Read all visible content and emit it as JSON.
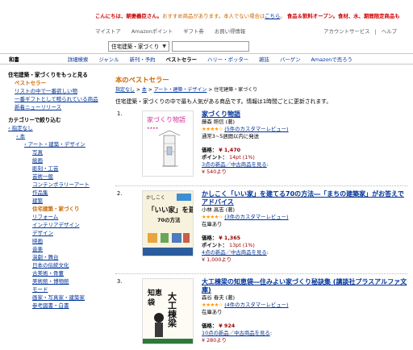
{
  "greeting": {
    "name": "こんにちは、朝妻義臣さん。",
    "mid": "おすすめ商品があります。本人でない場合は",
    "here": "こちら",
    "tail": "。",
    "promo": "食品＆飲料オープン。食材、水、期間限定商品も"
  },
  "topnav": [
    "マイストア",
    "Amazonポイント",
    "ギフト券",
    "お買い得情報"
  ],
  "account": {
    "service": "アカウントサービス",
    "sep": "|",
    "help": "ヘルプ"
  },
  "search": {
    "category": "住宅建築・家づくり",
    "value": ""
  },
  "catbar": {
    "home": "和書",
    "items": [
      "詳細検索",
      "ジャンル",
      "新刊・予約",
      "ベストセラー",
      "ハリー・ポッター",
      "雑誌",
      "バーゲン",
      "Amazonで売ろう"
    ],
    "selected": 3
  },
  "sidebar": {
    "heading": "住宅建築・家づくりをもっと見る",
    "selected": "ベストセラー",
    "links": [
      "リストの中で一番欲しい物",
      "一番ギフトとして贈られている商品",
      "新着ニューリリース"
    ],
    "filter_heading": "カテゴリーで絞り込む",
    "tree": [
      {
        "label": "‹ 指定なし",
        "level": 0,
        "current": false
      },
      {
        "label": "‹ 本",
        "level": 1,
        "current": false
      },
      {
        "label": "‹ アート・建築・デザイン",
        "level": 2,
        "current": false
      },
      {
        "label": "写真",
        "level": 3,
        "current": false
      },
      {
        "label": "絵画",
        "level": 3,
        "current": false
      },
      {
        "label": "彫刻・工芸",
        "level": 3,
        "current": false
      },
      {
        "label": "芸術一般",
        "level": 3,
        "current": false
      },
      {
        "label": "コンテンポラリーアート",
        "level": 3,
        "current": false
      },
      {
        "label": "作品集",
        "level": 3,
        "current": false
      },
      {
        "label": "建築",
        "level": 3,
        "current": false
      },
      {
        "label": "住宅建築・家づくり",
        "level": 3,
        "current": true
      },
      {
        "label": "リフォーム",
        "level": 3,
        "current": false
      },
      {
        "label": "インテリアデザイン",
        "level": 3,
        "current": false
      },
      {
        "label": "デザイン",
        "level": 3,
        "current": false
      },
      {
        "label": "映画",
        "level": 3,
        "current": false
      },
      {
        "label": "音楽",
        "level": 3,
        "current": false
      },
      {
        "label": "演劇・舞台",
        "level": 3,
        "current": false
      },
      {
        "label": "日本の伝統文化",
        "level": 3,
        "current": false
      },
      {
        "label": "古美術・骨董",
        "level": 3,
        "current": false
      },
      {
        "label": "美術館・博物館",
        "level": 3,
        "current": false
      },
      {
        "label": "モード",
        "level": 3,
        "current": false
      },
      {
        "label": "画家・写真家・建築家",
        "level": 3,
        "current": false
      },
      {
        "label": "参考図書・白書",
        "level": 3,
        "current": false
      }
    ]
  },
  "main": {
    "title": "本のベストセラー",
    "breadcrumb": [
      "指定なし",
      "本",
      "アート・建築・デザイン"
    ],
    "breadcrumb_current": "住宅建築・家づくり",
    "description": "住宅建築・家づくりの中で最も人気がある商品です。情報は1時間ごとに更新されます。"
  },
  "items": [
    {
      "rank": "1.",
      "cover_title": "家づくり物語",
      "title": "家づくり物語",
      "author": "藤森 照信 (著)",
      "rating": "★★★★☆",
      "reviews": "(5件のカスタマーレビュー)",
      "stock": "通常3~5週間以内に発送",
      "price_label": "価格：",
      "price": "¥ 1,470",
      "point_label": "ポイント：",
      "points": "14pt (1%)",
      "used": "3点の新品／中古商品を見る",
      "used_price": "¥ 540より"
    },
    {
      "rank": "2.",
      "cover_title": "「いい家」を建てる",
      "cover_sub": "70の方法",
      "cover_top": "かしこく",
      "title": "かしこく「いい家」を建てる70の方法―「まちの建築家」がお答えでアドバイス",
      "author": "小林 高志 (著)",
      "rating": "★★★★☆",
      "reviews": "(3件のカスタマーレビュー)",
      "stock": "在庫あり",
      "price_label": "価格：",
      "price": "¥ 1,365",
      "point_label": "ポイント：",
      "points": "13pt (1%)",
      "used": "4点の新品／中古商品を見る",
      "used_price": "¥ 1,000より"
    },
    {
      "rank": "3.",
      "cover_title": "大工棟梁の知恵袋",
      "title": "大工棟梁の知恵袋―住みよい家づくり秘訣集 (講談社プラスアルファ文庫)",
      "author": "森谷 春夫 (著)",
      "rating": "★★★★☆",
      "reviews": "(4件のカスタマーレビュー)",
      "stock": "在庫あり",
      "price_label": "価格：",
      "price": "¥ 924",
      "used": "10点の新品／中古商品を見る",
      "used_price": "¥ 280より"
    }
  ]
}
